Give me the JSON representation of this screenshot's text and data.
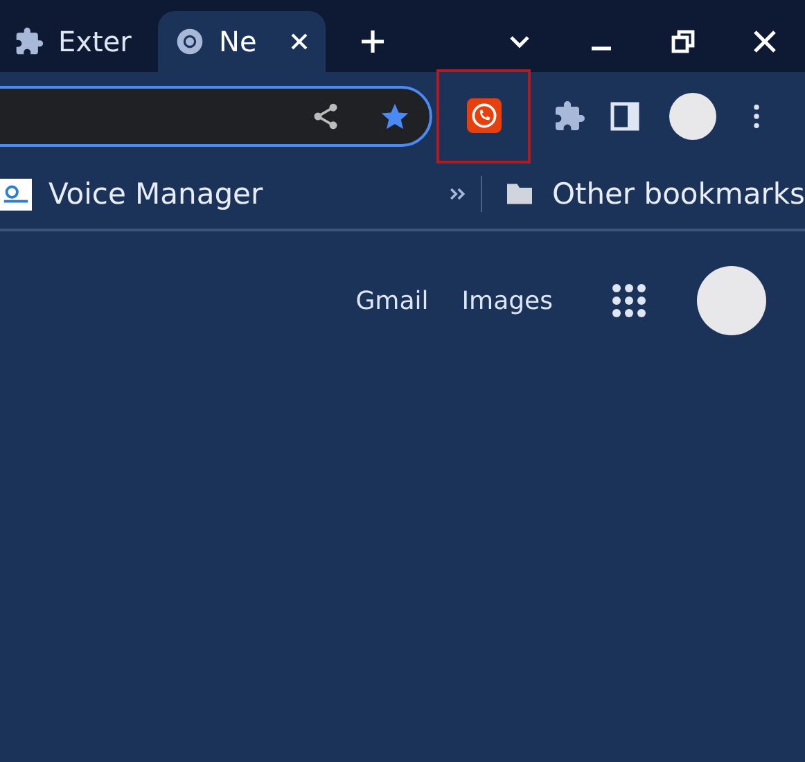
{
  "tabs": [
    {
      "title": "Exter",
      "kind": "extension",
      "selected": false
    },
    {
      "title": "Ne",
      "kind": "chrome",
      "selected": true
    }
  ],
  "toolbar": {
    "extension_highlighted": true
  },
  "bookmarks": {
    "items": [
      {
        "label": "Voice Manager"
      }
    ],
    "other": "Other bookmarks"
  },
  "page": {
    "links": [
      "Gmail",
      "Images"
    ]
  }
}
